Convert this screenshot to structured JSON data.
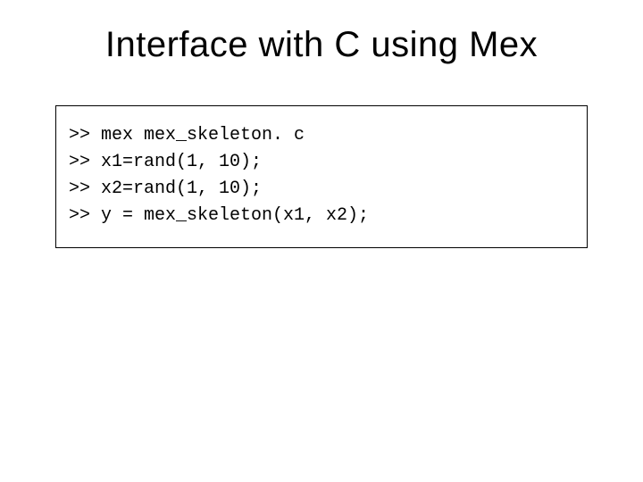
{
  "title": "Interface with C using Mex",
  "code": {
    "lines": [
      ">> mex mex_skeleton. c",
      ">> x1=rand(1, 10);",
      ">> x2=rand(1, 10);",
      ">> y = mex_skeleton(x1, x2);"
    ]
  }
}
